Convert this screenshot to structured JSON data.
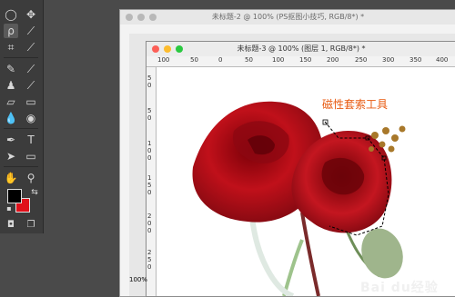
{
  "window_back": {
    "title": "未标题-2 @ 100% (PS抠图小技巧, RGB/8*) *"
  },
  "window_front": {
    "title": "未标题-3 @ 100% (图层 1, RGB/8*) *"
  },
  "ruler_top": [
    "100",
    "50",
    "0",
    "50",
    "100",
    "150",
    "200",
    "250",
    "300",
    "350",
    "400"
  ],
  "ruler_left": [
    "5",
    "0",
    "5",
    "0",
    "1",
    "0",
    "0",
    "1",
    "5",
    "0",
    "2",
    "0",
    "0",
    "2",
    "5",
    "0"
  ],
  "zoom_front": "100%",
  "zoom_back": "100%",
  "annotation": "磁性套索工具",
  "watermark": "Bai du经验",
  "colors": {
    "foreground": "#000000",
    "background": "#e0101a",
    "annotation": "#e85a10"
  }
}
